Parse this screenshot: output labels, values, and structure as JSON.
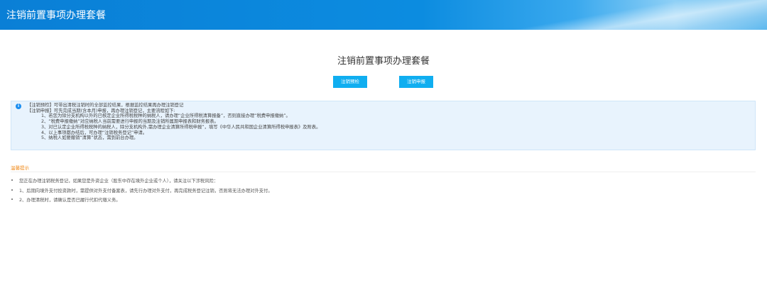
{
  "header": {
    "title": "注销前置事项办理套餐"
  },
  "main": {
    "title": "注销前置事项办理套餐",
    "buttons": [
      {
        "label": "注销预检"
      },
      {
        "label": "注销申报"
      }
    ],
    "info": {
      "icon": "info-icon",
      "lines": [
        "【注销预检】可带出清税注销时的全部监控结果，根据监控结果再办理注销登记",
        "【注销申报】可先完成当期(含本月)申报，再办理注销登记，主要流程如下:"
      ],
      "steps": [
        "1、若您为除分支机构以外的已核定企业所得税税种的纳税人，请办理“企业所得税清算报备”，否则直接办理“税费申报缴纳”。",
        "2、“税费申报缴纳”对应纳税人当前需要进行申报的当期及注销所属期申报表和财务报表。",
        "3、对已认定企业所得税税种的纳税人，除分支机构外,需办理企业清算所得税申报”，填写《中华人民共和国企业清算所得税申报表》及附表。",
        "4、以上事项都办结后，可办理“注销税务登记”申请。",
        "5、纳税人如要撤销“清算”状态，需到前台办理。"
      ]
    },
    "tips": {
      "title": "温馨提示",
      "items": [
        "您正在办理注销税务登记，如果您是外资企业（股东中存在境外企业或个人），请关注以下涉税风险：",
        "1、后期向境外支付投资款时，需提供对外支付备案表，请先行办理对外支付，再完成税务登记注销，否则将无法办理对外支付。",
        "2、办理清税时，请确认是否已履行代扣代缴义务。"
      ]
    }
  }
}
